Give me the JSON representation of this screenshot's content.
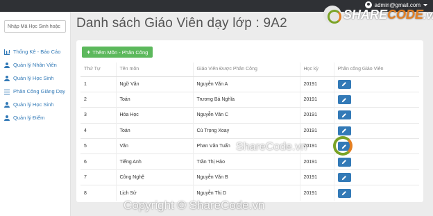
{
  "header": {
    "user_email": "admin@gmail.com",
    "user_icon": "user-icon",
    "menu_icon": "caret-down-icon"
  },
  "sidebar": {
    "search_placeholder": "Nhập Mã Học Sinh hoặc",
    "items": [
      {
        "label": "Thống Kê - Báo Cáo",
        "icon": "chart-icon"
      },
      {
        "label": "Quản lý Nhân Viên",
        "icon": "person-icon"
      },
      {
        "label": "Quản lý Học Sinh",
        "icon": "person-icon"
      },
      {
        "label": "Phân Công Giảng Dạy",
        "icon": "bars-icon"
      },
      {
        "label": "Quản lý Học Sinh",
        "icon": "person-icon"
      },
      {
        "label": "Quản lý Điểm",
        "icon": "person-icon"
      }
    ]
  },
  "main": {
    "title": "Danh sách Giáo Viên dạy lớp : 9A2",
    "add_button_label": "Thêm Môn - Phân Công",
    "add_button_color": "#5cb85c"
  },
  "table": {
    "headers": [
      "Thứ Tự",
      "Tên môn",
      "Giáo Viên Được Phân Công",
      "Học kỳ",
      "Phân công Giáo Viên"
    ],
    "rows": [
      [
        "1",
        "Ngữ Văn",
        "Nguyễn Văn A",
        "20191"
      ],
      [
        "2",
        "Toán",
        "Trương Bá Nghĩa",
        "20191"
      ],
      [
        "3",
        "Hóa Học",
        "Nguyễn Văn C",
        "20191"
      ],
      [
        "4",
        "Toán",
        "Cù Trọng Xoay",
        "20191"
      ],
      [
        "5",
        "Văn",
        "Phan Văn Tuấn",
        "20191"
      ],
      [
        "6",
        "Tiếng Anh",
        "Trần Thị Hảo",
        "20191"
      ],
      [
        "7",
        "Công Nghệ",
        "Nguyễn Văn B",
        "20191"
      ],
      [
        "8",
        "Lịch Sử",
        "Nguyễn Thị D",
        "20191"
      ]
    ],
    "edit_button_color": "#337ab7",
    "edit_icon": "pencil-icon"
  },
  "watermarks": {
    "logo_main": "SHARE",
    "logo_suffix": "CODE",
    "logo_domain": ".vn",
    "center": "ShareCode.vn",
    "bottom": "Copyright © ShareCode.vn"
  }
}
